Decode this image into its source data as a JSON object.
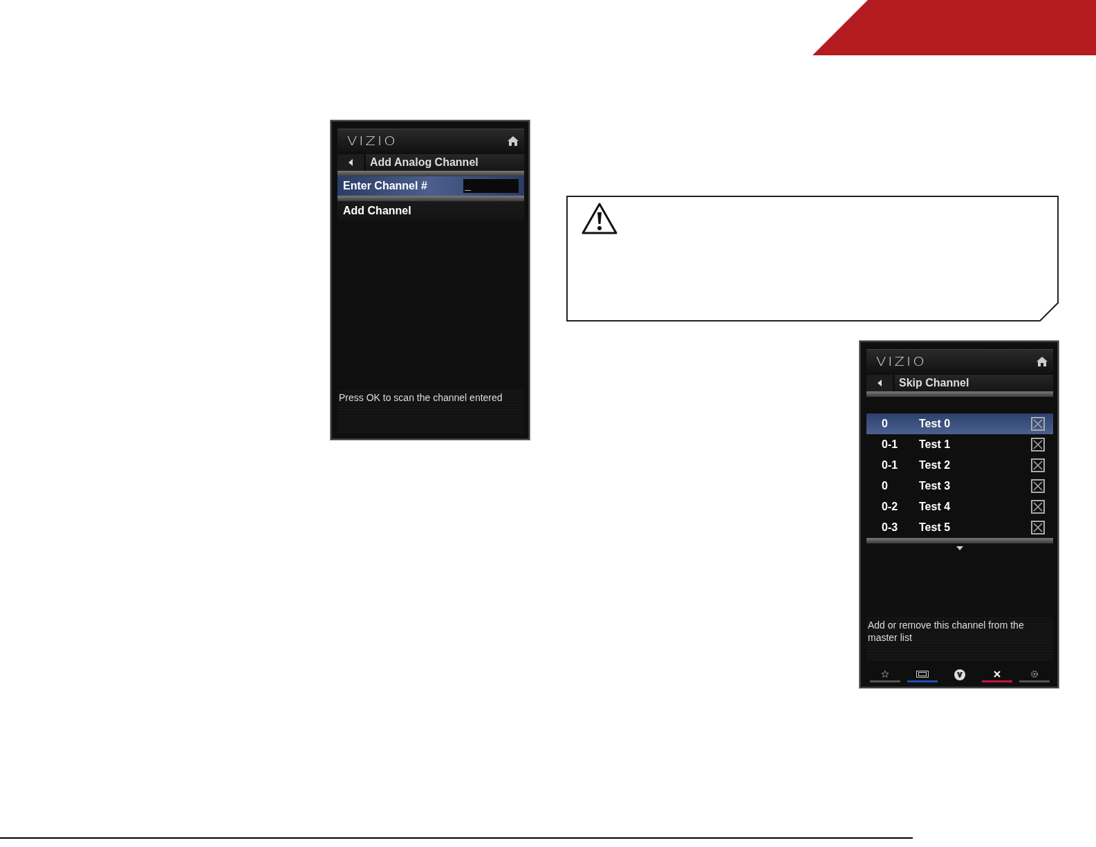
{
  "add_channel_panel": {
    "logo": "VIZIO",
    "title": "Add Analog Channel",
    "items": [
      {
        "kind": "input",
        "label": "Enter Channel #",
        "value": "_",
        "selected": true
      },
      {
        "kind": "action",
        "label": "Add Channel",
        "selected": false
      }
    ],
    "hint": "Press OK to scan the channel entered"
  },
  "caution_box": {
    "kind": "warning"
  },
  "skip_channel_panel": {
    "logo": "VIZIO",
    "title": "Skip Channel",
    "rows": [
      {
        "number": "0",
        "name": "Test 0",
        "checked": true,
        "selected": true
      },
      {
        "number": "0-1",
        "name": "Test 1",
        "checked": true,
        "selected": false
      },
      {
        "number": "0-1",
        "name": "Test 2",
        "checked": true,
        "selected": false
      },
      {
        "number": "0",
        "name": "Test 3",
        "checked": true,
        "selected": false
      },
      {
        "number": "0-2",
        "name": "Test 4",
        "checked": true,
        "selected": false
      },
      {
        "number": "0-3",
        "name": "Test 5",
        "checked": true,
        "selected": false
      }
    ],
    "hint": "Add or remove this channel from the master list",
    "footer_buttons": [
      {
        "kind": "star",
        "color": "#555555"
      },
      {
        "kind": "screen",
        "color": "#1f4fb8"
      },
      {
        "kind": "logo"
      },
      {
        "kind": "close",
        "color": "#c8143c"
      },
      {
        "kind": "gear",
        "color": "#555555"
      }
    ]
  }
}
